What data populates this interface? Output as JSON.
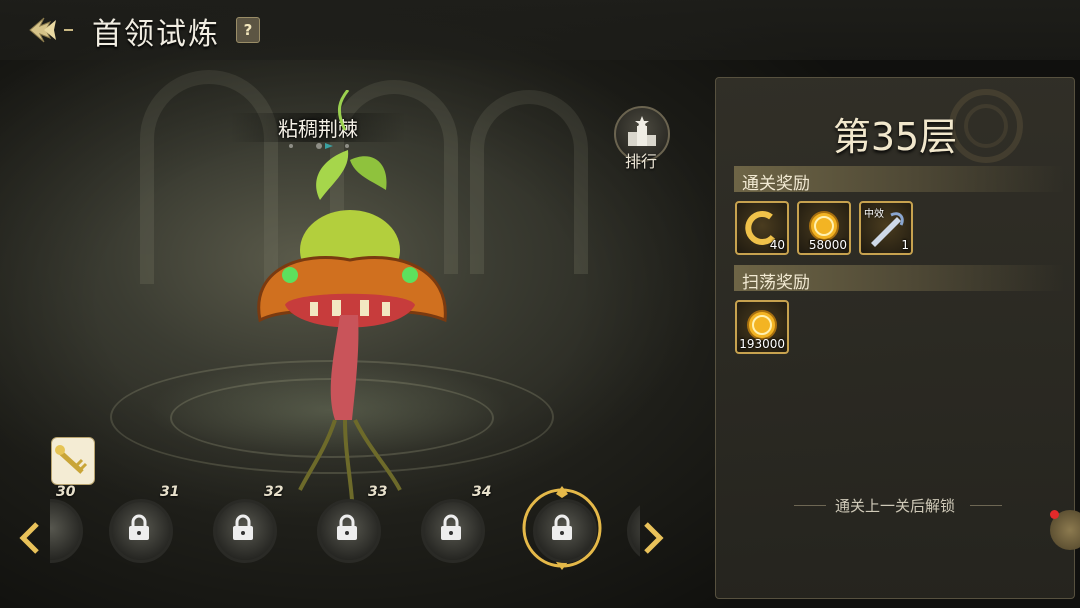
{
  "header": {
    "title": "首领试炼",
    "help_label": "?"
  },
  "boss": {
    "name": "粘稠荆棘"
  },
  "ranking": {
    "label": "排行",
    "icon": "ranking-icon"
  },
  "panel": {
    "floor_title": "第35层",
    "clear_rewards_title": "通关奖励",
    "clear_rewards": [
      {
        "icon": "token-icon",
        "count": "40"
      },
      {
        "icon": "gold-coin-icon",
        "count": "58000"
      },
      {
        "icon": "weapon-item-icon",
        "count": "1",
        "tag": "中效"
      }
    ],
    "sweep_rewards_title": "扫荡奖励",
    "sweep_rewards": [
      {
        "icon": "gold-coin-icon",
        "count": "193000"
      }
    ],
    "unlock_note": "通关上一关后解锁"
  },
  "floors": [
    {
      "label": "30",
      "locked": true
    },
    {
      "label": "31",
      "locked": true
    },
    {
      "label": "32",
      "locked": true
    },
    {
      "label": "33",
      "locked": true
    },
    {
      "label": "34",
      "locked": true
    },
    {
      "label": "",
      "locked": true,
      "selected": true
    }
  ],
  "colors": {
    "gold": "#c7a24f",
    "panel_bg": "#302e27",
    "text_light": "#f1e7cc",
    "notify_red": "#e32a2a"
  }
}
